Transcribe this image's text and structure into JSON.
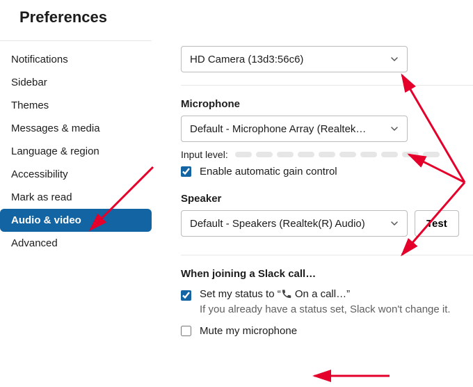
{
  "title": "Preferences",
  "sidebar": {
    "items": [
      {
        "label": "Notifications"
      },
      {
        "label": "Sidebar"
      },
      {
        "label": "Themes"
      },
      {
        "label": "Messages & media"
      },
      {
        "label": "Language & region"
      },
      {
        "label": "Accessibility"
      },
      {
        "label": "Mark as read"
      },
      {
        "label": "Audio & video"
      },
      {
        "label": "Advanced"
      }
    ],
    "active_index": 7
  },
  "camera": {
    "selected": "HD Camera (13d3:56c6)"
  },
  "microphone": {
    "label": "Microphone",
    "selected": "Default - Microphone Array (Realtek…",
    "input_level_label": "Input level:",
    "agc_label": "Enable automatic gain control",
    "agc_checked": true
  },
  "speaker": {
    "label": "Speaker",
    "selected": "Default - Speakers (Realtek(R) Audio)",
    "test_label": "Test"
  },
  "joining": {
    "heading": "When joining a Slack call…",
    "status_label_pre": "Set my status to “",
    "status_label_mid": " On a call…”",
    "status_checked": true,
    "status_note": "If you already have a status set, Slack won't change it.",
    "mute_label": "Mute my microphone",
    "mute_checked": false
  },
  "annotation_color": "#e4002b"
}
